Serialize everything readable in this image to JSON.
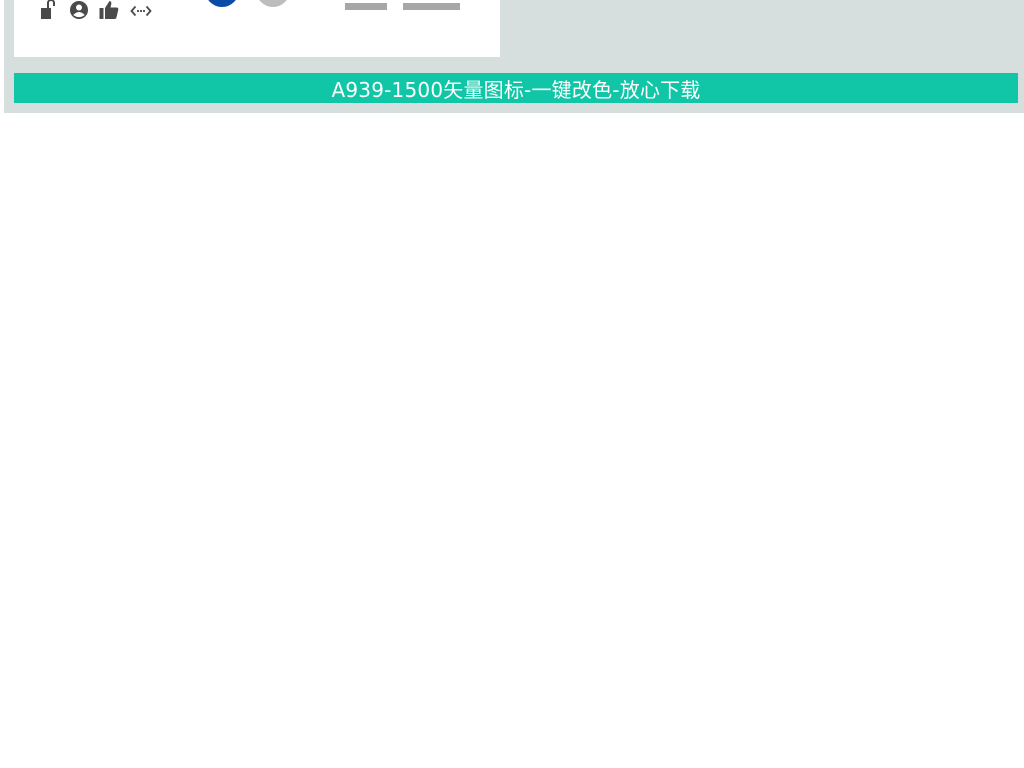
{
  "caption": {
    "text": "A939-1500矢量图标-一键改色-放心下载",
    "color": "#10c6a6"
  },
  "preview": {
    "icons": [
      "lock-open-icon",
      "account-circle-icon",
      "thumbs-up-icon",
      "code-brackets-icon"
    ],
    "icon_color": "#4a4a4a",
    "swatches": [
      "#0b4aa6",
      "#bdbdbd"
    ],
    "placeholder_color": "#a7a7a7"
  },
  "theme": {
    "frame_bg": "#d6dfde",
    "card_bg": "#ffffff"
  }
}
